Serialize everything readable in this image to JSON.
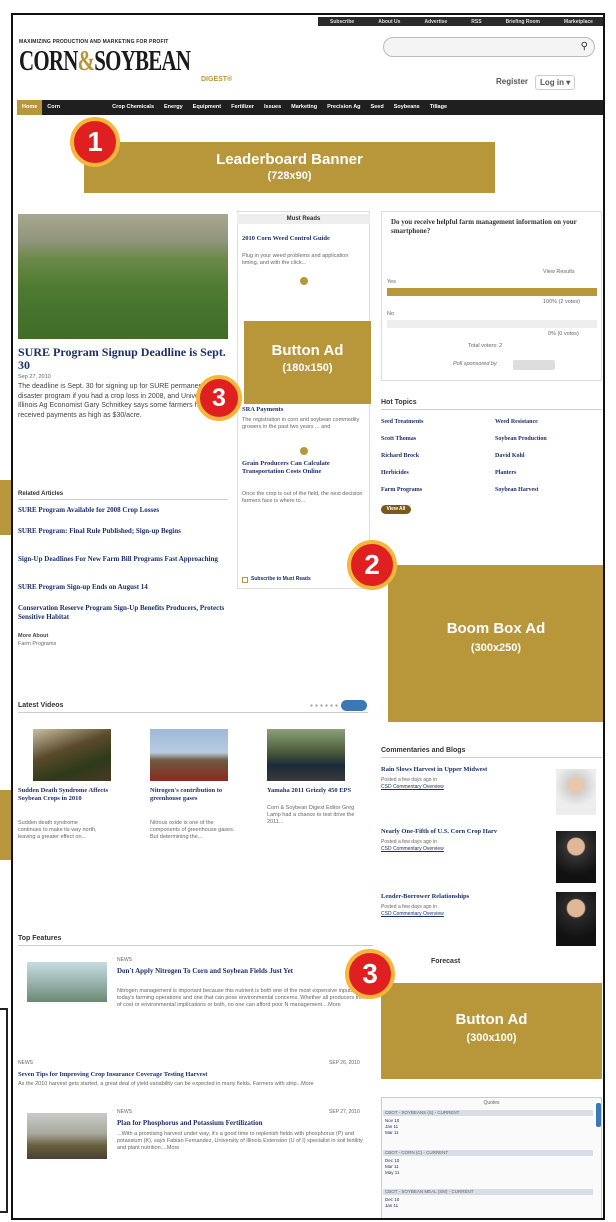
{
  "utility_nav": [
    "Subscribe",
    "About Us",
    "Advertise",
    "RSS",
    "Briefing Room",
    "Marketplace"
  ],
  "header": {
    "tagline": "MAXIMIZING PRODUCTION AND MARKETING FOR PROFIT",
    "logo_a": "CORN",
    "logo_amp": "&",
    "logo_b": "SOYBEAN",
    "logo_sub": "DIGEST®",
    "register": "Register",
    "login": "Log in ▾"
  },
  "nav": [
    "Home",
    "Corn",
    "Crop Chemicals",
    "Energy",
    "Equipment",
    "Fertilizer",
    "Issues",
    "Marketing",
    "Precision Ag",
    "Seed",
    "Soybeans",
    "Tillage"
  ],
  "ads": {
    "leaderboard": {
      "number": "1",
      "title": "Leaderboard Banner",
      "size": "(728x90)"
    },
    "button1": {
      "number": "3",
      "title": "Button Ad",
      "size": "(180x150)"
    },
    "boombox": {
      "number": "2",
      "title": "Boom Box Ad",
      "size": "(300x250)"
    },
    "button2": {
      "number": "3",
      "title": "Button Ad",
      "size": "(300x100)"
    }
  },
  "lead_story": {
    "title": "SURE Program Signup Deadline is Sept. 30",
    "date": "Sep 27, 2010",
    "body": "The deadline is Sept. 30 for signing up for SURE permanent disaster program if you had a crop loss in 2008, and University of Illinois Ag Economist Gary Schnitkey says some farmers have received payments as high as $30/acre."
  },
  "related": {
    "heading": "Related Articles",
    "items": [
      "SURE Program Available for 2008 Crop Losses",
      "SURE Program: Final Rule Published; Sign-up Begins",
      "Sign-Up Deadlines For New Farm Bill Programs Fast Approaching",
      "SURE Program Sign-up Ends on August 14",
      "Conservation Reserve Program Sign-Up Benefits Producers, Protects Sensitive Habitat"
    ],
    "more_label": "More About",
    "more_tag": "Farm Programs"
  },
  "must_reads": {
    "heading": "Must Reads",
    "items": [
      {
        "title": "2010 Corn Weed Control Guide",
        "text": "Plug in your weed problems and application timing, and with the click..."
      },
      {
        "title": "SRA Payments",
        "text": "The registration in corn and soybean commodity growers in the past two years ... and"
      },
      {
        "title": "Grain Producers Can Calculate Transportation Costs Online",
        "text": "Once the crop is out of the field, the next decision farmers face is where to..."
      }
    ],
    "subscribe": "Subscribe to Must Reads"
  },
  "poll": {
    "question": "Do you receive helpful farm management information on your smartphone?",
    "view_results": "View Results",
    "options": [
      {
        "label": "Yes",
        "pct_text": "100% (2 votes)",
        "share": 1.0
      },
      {
        "label": "No",
        "pct_text": "0% (0 votes)",
        "share": 0.0
      }
    ],
    "total": "Total voters: 2",
    "sponsor": "Poll sponsored by"
  },
  "hot_topics": {
    "heading": "Hot Topics",
    "items": [
      "Seed Treatments",
      "Weed Resistance",
      "Scott Thomas",
      "Soybean Production",
      "Richard Brock",
      "David Kohl",
      "Herbicides",
      "Planters",
      "Farm Programs",
      "Soybean Harvest"
    ],
    "button": "View All"
  },
  "videos": {
    "heading": "Latest Videos",
    "items": [
      {
        "title": "Sudden Death Syndrome Affects Soybean Crops in 2010",
        "text": "Sudden death syndrome continues to make its way north, leaving a greater effect on..."
      },
      {
        "title": "Nitrogen's contribution to greenhouse gases",
        "text": "Nitrous oxide is one of the components of greenhouse gases. But determining the..."
      },
      {
        "title": "Yamaha 2011 Grizzly 450 EPS",
        "text": "Corn & Soybean Digest Editor Greg Lamp had a chance to test drive the 2011..."
      }
    ]
  },
  "blogs": {
    "heading": "Commentaries and Blogs",
    "items": [
      {
        "title": "Rain Slows Harvest in Upper Midwest",
        "meta": "Posted a few days ago in",
        "author": "CSD Commentary Overview"
      },
      {
        "title": "Nearly One-Fifth of U.S. Corn Crop Harv",
        "meta": "Posted a few days ago in",
        "author": "CSD Commentary Overview"
      },
      {
        "title": "Lender-Borrower Relationships",
        "meta": "Posted a few days ago in",
        "author": "CSD Commentary Overview"
      }
    ]
  },
  "top_features": {
    "heading": "Top Features",
    "items": [
      {
        "tag": "NEWS",
        "date": "SEP 27, 2010",
        "title": "Don't Apply Nitrogen To Corn and Soybean Fields Just Yet",
        "text": "Nitrogen management is important because this nutrient is both one of the most expensive inputs in today's farming operations and one that can pose environmental concerns. Whether all producers think of cost or environmental implications or both, no one can afford poor N management....More"
      },
      {
        "tag": "NEWS",
        "date": "SEP 26, 2010",
        "title": "Seven Tips for Improving Crop Insurance Coverage Testing Harvest",
        "text": "As the 2010 harvest gets started, a great deal of yield variability can be expected in many fields. Farmers with strip...More"
      },
      {
        "tag": "NEWS",
        "date": "SEP 27, 2010",
        "title": "Plan for Phosphorus and Potassium Fertilization",
        "text": "...With a promising harvest under way, it's a good time to replenish fields with phosphorus (P) and potassium (K), says Fabian Fernandez, University of Illinois Extension (U of I) specialist in soil fertility and plant nutrition....More"
      }
    ]
  },
  "weather": {
    "heading": "Forecast"
  },
  "quotes": {
    "heading": "Quotes",
    "groups": [
      {
        "name": "CBOT - SOYBEANS (S) - CURRENT",
        "rows": [
          "Nov 10",
          "Jan 11",
          "Mar 11"
        ]
      },
      {
        "name": "CBOT - CORN (C) - CURRENT",
        "rows": [
          "Dec 10",
          "Mar 11",
          "May 11"
        ]
      },
      {
        "name": "CBOT - SOYBEAN MEAL (SM) - CURRENT",
        "rows": [
          "Dec 10",
          "Jan 11"
        ]
      }
    ]
  },
  "colors": {
    "gold": "#b8963a",
    "navy": "#1d2f6a",
    "badge_red": "#e02020"
  }
}
